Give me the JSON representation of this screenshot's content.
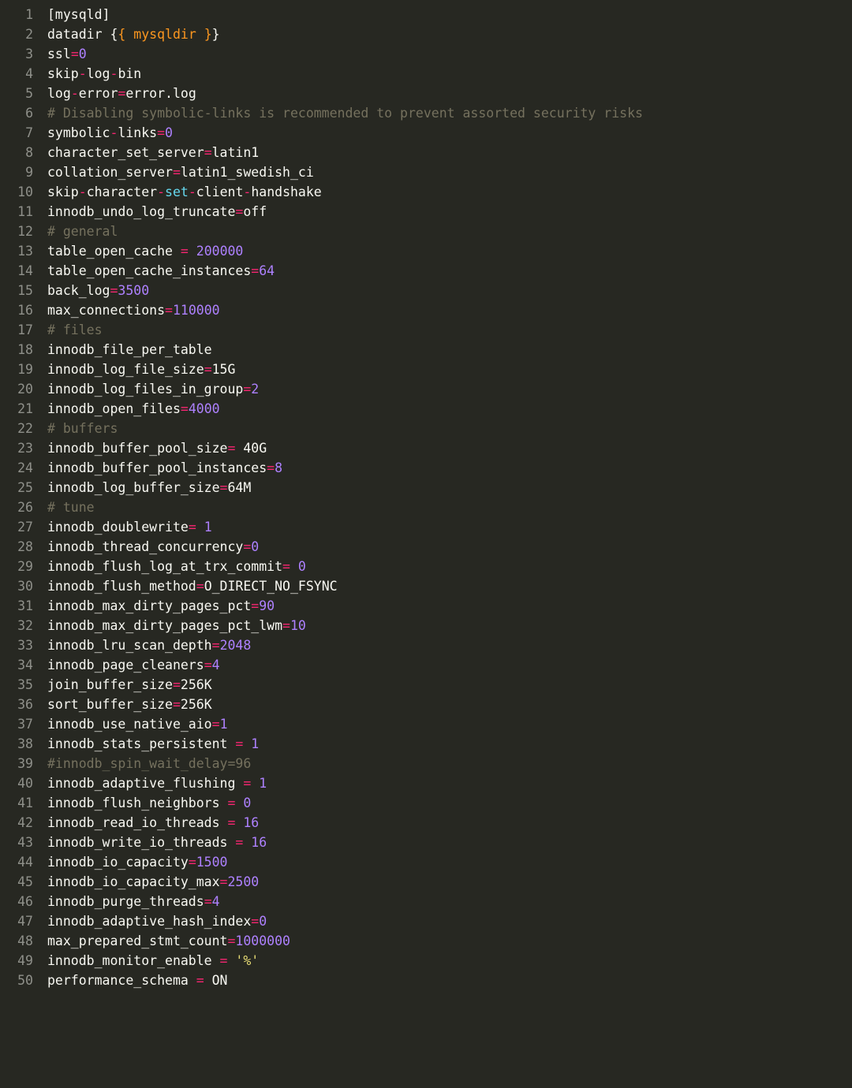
{
  "lines": [
    {
      "n": 1,
      "tokens": [
        {
          "t": "[mysqld]",
          "c": "white"
        }
      ]
    },
    {
      "n": 2,
      "tokens": [
        {
          "t": "datadir ",
          "c": "white"
        },
        {
          "t": "{",
          "c": "white"
        },
        {
          "t": "{",
          "c": "orange"
        },
        {
          "t": " mysqldir ",
          "c": "orange"
        },
        {
          "t": "}",
          "c": "orange"
        },
        {
          "t": "}",
          "c": "white"
        }
      ]
    },
    {
      "n": 3,
      "tokens": [
        {
          "t": "ssl",
          "c": "white"
        },
        {
          "t": "=",
          "c": "pink"
        },
        {
          "t": "0",
          "c": "purple"
        }
      ]
    },
    {
      "n": 4,
      "tokens": [
        {
          "t": "skip",
          "c": "white"
        },
        {
          "t": "-",
          "c": "pink"
        },
        {
          "t": "log",
          "c": "white"
        },
        {
          "t": "-",
          "c": "pink"
        },
        {
          "t": "bin",
          "c": "white"
        }
      ]
    },
    {
      "n": 5,
      "tokens": [
        {
          "t": "log",
          "c": "white"
        },
        {
          "t": "-",
          "c": "pink"
        },
        {
          "t": "error",
          "c": "white"
        },
        {
          "t": "=",
          "c": "pink"
        },
        {
          "t": "error.log",
          "c": "white"
        }
      ]
    },
    {
      "n": 6,
      "tokens": [
        {
          "t": "# Disabling symbolic-links is recommended to prevent assorted security risks",
          "c": "grey"
        }
      ]
    },
    {
      "n": 7,
      "tokens": [
        {
          "t": "symbolic",
          "c": "white"
        },
        {
          "t": "-",
          "c": "pink"
        },
        {
          "t": "links",
          "c": "white"
        },
        {
          "t": "=",
          "c": "pink"
        },
        {
          "t": "0",
          "c": "purple"
        }
      ]
    },
    {
      "n": 8,
      "tokens": [
        {
          "t": "character_set_server",
          "c": "white"
        },
        {
          "t": "=",
          "c": "pink"
        },
        {
          "t": "latin1",
          "c": "white"
        }
      ]
    },
    {
      "n": 9,
      "tokens": [
        {
          "t": "collation_server",
          "c": "white"
        },
        {
          "t": "=",
          "c": "pink"
        },
        {
          "t": "latin1_swedish_ci",
          "c": "white"
        }
      ]
    },
    {
      "n": 10,
      "tokens": [
        {
          "t": "skip",
          "c": "white"
        },
        {
          "t": "-",
          "c": "pink"
        },
        {
          "t": "character",
          "c": "white"
        },
        {
          "t": "-",
          "c": "pink"
        },
        {
          "t": "set",
          "c": "blue"
        },
        {
          "t": "-",
          "c": "pink"
        },
        {
          "t": "client",
          "c": "white"
        },
        {
          "t": "-",
          "c": "pink"
        },
        {
          "t": "handshake",
          "c": "white"
        }
      ]
    },
    {
      "n": 11,
      "tokens": [
        {
          "t": "innodb_undo_log_truncate",
          "c": "white"
        },
        {
          "t": "=",
          "c": "pink"
        },
        {
          "t": "off",
          "c": "white"
        }
      ]
    },
    {
      "n": 12,
      "tokens": [
        {
          "t": "# general",
          "c": "grey"
        }
      ]
    },
    {
      "n": 13,
      "tokens": [
        {
          "t": "table_open_cache ",
          "c": "white"
        },
        {
          "t": "=",
          "c": "pink"
        },
        {
          "t": " ",
          "c": "white"
        },
        {
          "t": "200000",
          "c": "purple"
        }
      ]
    },
    {
      "n": 14,
      "tokens": [
        {
          "t": "table_open_cache_instances",
          "c": "white"
        },
        {
          "t": "=",
          "c": "pink"
        },
        {
          "t": "64",
          "c": "purple"
        }
      ]
    },
    {
      "n": 15,
      "tokens": [
        {
          "t": "back_log",
          "c": "white"
        },
        {
          "t": "=",
          "c": "pink"
        },
        {
          "t": "3500",
          "c": "purple"
        }
      ]
    },
    {
      "n": 16,
      "tokens": [
        {
          "t": "max_connections",
          "c": "white"
        },
        {
          "t": "=",
          "c": "pink"
        },
        {
          "t": "110000",
          "c": "purple"
        }
      ]
    },
    {
      "n": 17,
      "tokens": [
        {
          "t": "# files",
          "c": "grey"
        }
      ]
    },
    {
      "n": 18,
      "tokens": [
        {
          "t": "innodb_file_per_table",
          "c": "white"
        }
      ]
    },
    {
      "n": 19,
      "tokens": [
        {
          "t": "innodb_log_file_size",
          "c": "white"
        },
        {
          "t": "=",
          "c": "pink"
        },
        {
          "t": "15G",
          "c": "white"
        }
      ]
    },
    {
      "n": 20,
      "tokens": [
        {
          "t": "innodb_log_files_in_group",
          "c": "white"
        },
        {
          "t": "=",
          "c": "pink"
        },
        {
          "t": "2",
          "c": "purple"
        }
      ]
    },
    {
      "n": 21,
      "tokens": [
        {
          "t": "innodb_open_files",
          "c": "white"
        },
        {
          "t": "=",
          "c": "pink"
        },
        {
          "t": "4000",
          "c": "purple"
        }
      ]
    },
    {
      "n": 22,
      "tokens": [
        {
          "t": "# buffers",
          "c": "grey"
        }
      ]
    },
    {
      "n": 23,
      "tokens": [
        {
          "t": "innodb_buffer_pool_size",
          "c": "white"
        },
        {
          "t": "=",
          "c": "pink"
        },
        {
          "t": " 40G",
          "c": "white"
        }
      ]
    },
    {
      "n": 24,
      "tokens": [
        {
          "t": "innodb_buffer_pool_instances",
          "c": "white"
        },
        {
          "t": "=",
          "c": "pink"
        },
        {
          "t": "8",
          "c": "purple"
        }
      ]
    },
    {
      "n": 25,
      "tokens": [
        {
          "t": "innodb_log_buffer_size",
          "c": "white"
        },
        {
          "t": "=",
          "c": "pink"
        },
        {
          "t": "64M",
          "c": "white"
        }
      ]
    },
    {
      "n": 26,
      "tokens": [
        {
          "t": "# tune",
          "c": "grey"
        }
      ]
    },
    {
      "n": 27,
      "tokens": [
        {
          "t": "innodb_doublewrite",
          "c": "white"
        },
        {
          "t": "=",
          "c": "pink"
        },
        {
          "t": " ",
          "c": "white"
        },
        {
          "t": "1",
          "c": "purple"
        }
      ]
    },
    {
      "n": 28,
      "tokens": [
        {
          "t": "innodb_thread_concurrency",
          "c": "white"
        },
        {
          "t": "=",
          "c": "pink"
        },
        {
          "t": "0",
          "c": "purple"
        }
      ]
    },
    {
      "n": 29,
      "tokens": [
        {
          "t": "innodb_flush_log_at_trx_commit",
          "c": "white"
        },
        {
          "t": "=",
          "c": "pink"
        },
        {
          "t": " ",
          "c": "white"
        },
        {
          "t": "0",
          "c": "purple"
        }
      ]
    },
    {
      "n": 30,
      "tokens": [
        {
          "t": "innodb_flush_method",
          "c": "white"
        },
        {
          "t": "=",
          "c": "pink"
        },
        {
          "t": "O_DIRECT_NO_FSYNC",
          "c": "white"
        }
      ]
    },
    {
      "n": 31,
      "tokens": [
        {
          "t": "innodb_max_dirty_pages_pct",
          "c": "white"
        },
        {
          "t": "=",
          "c": "pink"
        },
        {
          "t": "90",
          "c": "purple"
        }
      ]
    },
    {
      "n": 32,
      "tokens": [
        {
          "t": "innodb_max_dirty_pages_pct_lwm",
          "c": "white"
        },
        {
          "t": "=",
          "c": "pink"
        },
        {
          "t": "10",
          "c": "purple"
        }
      ]
    },
    {
      "n": 33,
      "tokens": [
        {
          "t": "innodb_lru_scan_depth",
          "c": "white"
        },
        {
          "t": "=",
          "c": "pink"
        },
        {
          "t": "2048",
          "c": "purple"
        }
      ]
    },
    {
      "n": 34,
      "tokens": [
        {
          "t": "innodb_page_cleaners",
          "c": "white"
        },
        {
          "t": "=",
          "c": "pink"
        },
        {
          "t": "4",
          "c": "purple"
        }
      ]
    },
    {
      "n": 35,
      "tokens": [
        {
          "t": "join_buffer_size",
          "c": "white"
        },
        {
          "t": "=",
          "c": "pink"
        },
        {
          "t": "256K",
          "c": "white"
        }
      ]
    },
    {
      "n": 36,
      "tokens": [
        {
          "t": "sort_buffer_size",
          "c": "white"
        },
        {
          "t": "=",
          "c": "pink"
        },
        {
          "t": "256K",
          "c": "white"
        }
      ]
    },
    {
      "n": 37,
      "tokens": [
        {
          "t": "innodb_use_native_aio",
          "c": "white"
        },
        {
          "t": "=",
          "c": "pink"
        },
        {
          "t": "1",
          "c": "purple"
        }
      ]
    },
    {
      "n": 38,
      "tokens": [
        {
          "t": "innodb_stats_persistent ",
          "c": "white"
        },
        {
          "t": "=",
          "c": "pink"
        },
        {
          "t": " ",
          "c": "white"
        },
        {
          "t": "1",
          "c": "purple"
        }
      ]
    },
    {
      "n": 39,
      "tokens": [
        {
          "t": "#innodb_spin_wait_delay=96",
          "c": "grey"
        }
      ]
    },
    {
      "n": 40,
      "tokens": [
        {
          "t": "innodb_adaptive_flushing ",
          "c": "white"
        },
        {
          "t": "=",
          "c": "pink"
        },
        {
          "t": " ",
          "c": "white"
        },
        {
          "t": "1",
          "c": "purple"
        }
      ]
    },
    {
      "n": 41,
      "tokens": [
        {
          "t": "innodb_flush_neighbors ",
          "c": "white"
        },
        {
          "t": "=",
          "c": "pink"
        },
        {
          "t": " ",
          "c": "white"
        },
        {
          "t": "0",
          "c": "purple"
        }
      ]
    },
    {
      "n": 42,
      "tokens": [
        {
          "t": "innodb_read_io_threads ",
          "c": "white"
        },
        {
          "t": "=",
          "c": "pink"
        },
        {
          "t": " ",
          "c": "white"
        },
        {
          "t": "16",
          "c": "purple"
        }
      ]
    },
    {
      "n": 43,
      "tokens": [
        {
          "t": "innodb_write_io_threads ",
          "c": "white"
        },
        {
          "t": "=",
          "c": "pink"
        },
        {
          "t": " ",
          "c": "white"
        },
        {
          "t": "16",
          "c": "purple"
        }
      ]
    },
    {
      "n": 44,
      "tokens": [
        {
          "t": "innodb_io_capacity",
          "c": "white"
        },
        {
          "t": "=",
          "c": "pink"
        },
        {
          "t": "1500",
          "c": "purple"
        }
      ]
    },
    {
      "n": 45,
      "tokens": [
        {
          "t": "innodb_io_capacity_max",
          "c": "white"
        },
        {
          "t": "=",
          "c": "pink"
        },
        {
          "t": "2500",
          "c": "purple"
        }
      ]
    },
    {
      "n": 46,
      "tokens": [
        {
          "t": "innodb_purge_threads",
          "c": "white"
        },
        {
          "t": "=",
          "c": "pink"
        },
        {
          "t": "4",
          "c": "purple"
        }
      ]
    },
    {
      "n": 47,
      "tokens": [
        {
          "t": "innodb_adaptive_hash_index",
          "c": "white"
        },
        {
          "t": "=",
          "c": "pink"
        },
        {
          "t": "0",
          "c": "purple"
        }
      ]
    },
    {
      "n": 48,
      "tokens": [
        {
          "t": "max_prepared_stmt_count",
          "c": "white"
        },
        {
          "t": "=",
          "c": "pink"
        },
        {
          "t": "1000000",
          "c": "purple"
        }
      ]
    },
    {
      "n": 49,
      "tokens": [
        {
          "t": "innodb_monitor_enable ",
          "c": "white"
        },
        {
          "t": "=",
          "c": "pink"
        },
        {
          "t": " ",
          "c": "white"
        },
        {
          "t": "'%'",
          "c": "yellow"
        }
      ]
    },
    {
      "n": 50,
      "tokens": [
        {
          "t": "performance_schema ",
          "c": "white"
        },
        {
          "t": "=",
          "c": "pink"
        },
        {
          "t": " ON",
          "c": "white"
        }
      ]
    }
  ]
}
